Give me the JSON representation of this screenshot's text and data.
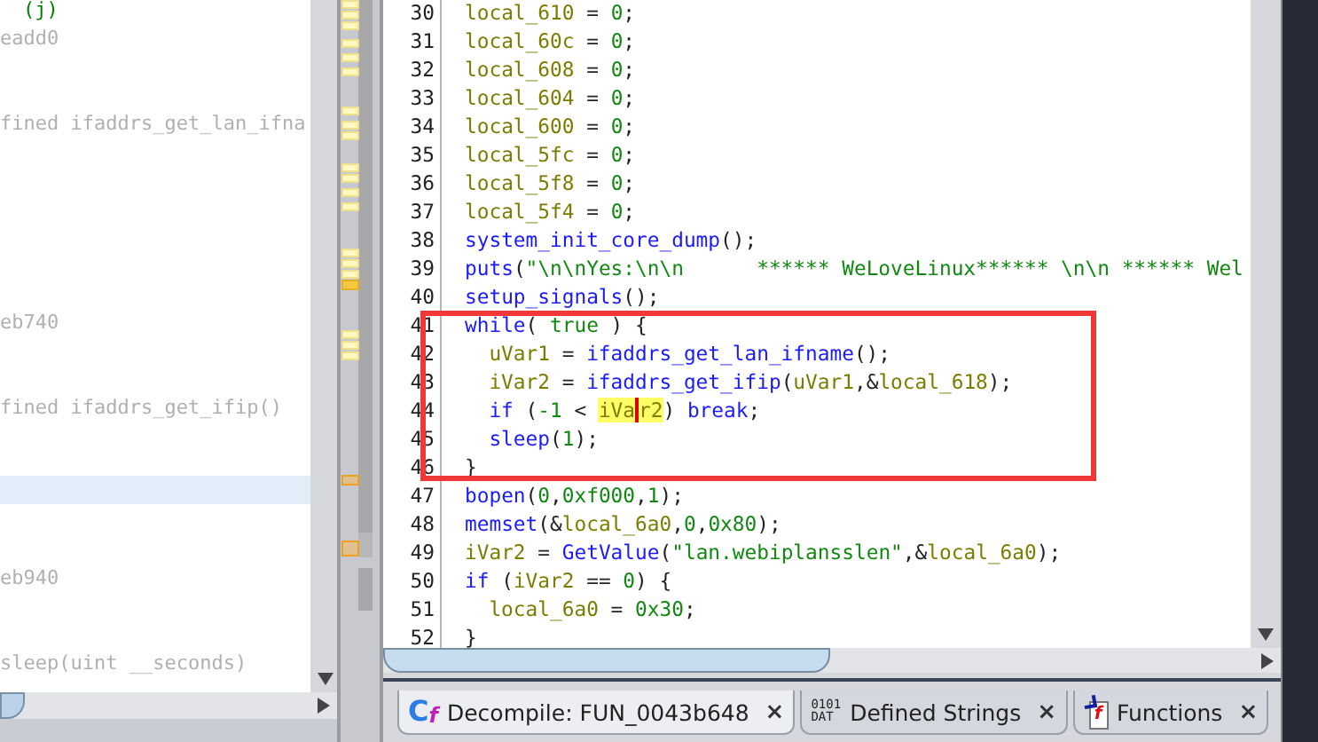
{
  "listing": {
    "lines": [
      {
        "text": "(j)",
        "kind": "code",
        "selected": false
      },
      {
        "text": "eadd0",
        "kind": "addr",
        "selected": false
      },
      {
        "selected": false
      },
      {
        "selected": false
      },
      {
        "text": "fined ifaddrs_get_lan_ifna",
        "kind": "addr",
        "selected": false
      },
      {
        "selected": false
      },
      {
        "selected": false
      },
      {
        "selected": false
      },
      {
        "selected": false
      },
      {
        "selected": false
      },
      {
        "selected": false
      },
      {
        "text": "eb740",
        "kind": "addr",
        "selected": false
      },
      {
        "selected": false
      },
      {
        "selected": false
      },
      {
        "text": "fined ifaddrs_get_ifip()",
        "kind": "addr",
        "selected": false
      },
      {
        "selected": false
      },
      {
        "selected": false
      },
      {
        "selected": true
      },
      {
        "selected": false
      },
      {
        "selected": false
      },
      {
        "text": "eb940",
        "kind": "addr",
        "selected": false
      },
      {
        "selected": false
      },
      {
        "selected": false
      },
      {
        "text": "sleep(uint __seconds)",
        "kind": "addr",
        "selected": false
      }
    ]
  },
  "decompiler": {
    "lines": [
      {
        "number": "30",
        "boxed": false,
        "tokens": [
          {
            "kind": "var",
            "t": "local_610"
          },
          {
            "kind": "p",
            "t": " = "
          },
          {
            "kind": "num",
            "t": "0"
          },
          {
            "kind": "p",
            "t": ";"
          }
        ]
      },
      {
        "number": "31",
        "boxed": false,
        "tokens": [
          {
            "kind": "var",
            "t": "local_60c"
          },
          {
            "kind": "p",
            "t": " = "
          },
          {
            "kind": "num",
            "t": "0"
          },
          {
            "kind": "p",
            "t": ";"
          }
        ]
      },
      {
        "number": "32",
        "boxed": false,
        "tokens": [
          {
            "kind": "var",
            "t": "local_608"
          },
          {
            "kind": "p",
            "t": " = "
          },
          {
            "kind": "num",
            "t": "0"
          },
          {
            "kind": "p",
            "t": ";"
          }
        ]
      },
      {
        "number": "33",
        "boxed": false,
        "tokens": [
          {
            "kind": "var",
            "t": "local_604"
          },
          {
            "kind": "p",
            "t": " = "
          },
          {
            "kind": "num",
            "t": "0"
          },
          {
            "kind": "p",
            "t": ";"
          }
        ]
      },
      {
        "number": "34",
        "boxed": false,
        "tokens": [
          {
            "kind": "var",
            "t": "local_600"
          },
          {
            "kind": "p",
            "t": " = "
          },
          {
            "kind": "num",
            "t": "0"
          },
          {
            "kind": "p",
            "t": ";"
          }
        ]
      },
      {
        "number": "35",
        "boxed": false,
        "tokens": [
          {
            "kind": "var",
            "t": "local_5fc"
          },
          {
            "kind": "p",
            "t": " = "
          },
          {
            "kind": "num",
            "t": "0"
          },
          {
            "kind": "p",
            "t": ";"
          }
        ]
      },
      {
        "number": "36",
        "boxed": false,
        "tokens": [
          {
            "kind": "var",
            "t": "local_5f8"
          },
          {
            "kind": "p",
            "t": " = "
          },
          {
            "kind": "num",
            "t": "0"
          },
          {
            "kind": "p",
            "t": ";"
          }
        ]
      },
      {
        "number": "37",
        "boxed": false,
        "tokens": [
          {
            "kind": "var",
            "t": "local_5f4"
          },
          {
            "kind": "p",
            "t": " = "
          },
          {
            "kind": "num",
            "t": "0"
          },
          {
            "kind": "p",
            "t": ";"
          }
        ]
      },
      {
        "number": "38",
        "boxed": false,
        "tokens": [
          {
            "kind": "fn",
            "t": "system_init_core_dump"
          },
          {
            "kind": "p",
            "t": "();"
          }
        ]
      },
      {
        "number": "39",
        "boxed": false,
        "tokens": [
          {
            "kind": "fn",
            "t": "puts"
          },
          {
            "kind": "p",
            "t": "("
          },
          {
            "kind": "str",
            "t": "\"\\n\\nYes:\\n\\n      ****** WeLoveLinux****** \\n\\n ****** Wel"
          }
        ]
      },
      {
        "number": "40",
        "boxed": false,
        "tokens": [
          {
            "kind": "fn",
            "t": "setup_signals"
          },
          {
            "kind": "p",
            "t": "();"
          }
        ]
      },
      {
        "number": "41",
        "boxed": true,
        "tokens": [
          {
            "kind": "fn",
            "t": "while"
          },
          {
            "kind": "p",
            "t": "( "
          },
          {
            "kind": "num",
            "t": "true"
          },
          {
            "kind": "p",
            "t": " ) {"
          }
        ],
        "children": [
          {
            "number": "42",
            "boxed": true,
            "tokens": [
              {
                "kind": "var",
                "t": "uVar1"
              },
              {
                "kind": "p",
                "t": " = "
              },
              {
                "kind": "fn",
                "t": "ifaddrs_get_lan_ifname"
              },
              {
                "kind": "p",
                "t": "();"
              }
            ]
          },
          {
            "number": "43",
            "boxed": true,
            "tokens": [
              {
                "kind": "var",
                "t": "iVar2"
              },
              {
                "kind": "p",
                "t": " = "
              },
              {
                "kind": "fn",
                "t": "ifaddrs_get_ifip"
              },
              {
                "kind": "p",
                "t": "("
              },
              {
                "kind": "var",
                "t": "uVar1"
              },
              {
                "kind": "p",
                "t": ",&"
              },
              {
                "kind": "var",
                "t": "local_618"
              },
              {
                "kind": "p",
                "t": ");"
              }
            ]
          },
          {
            "number": "44",
            "boxed": true,
            "tokens": [
              {
                "kind": "fn",
                "t": "if"
              },
              {
                "kind": "p",
                "t": " ("
              },
              {
                "kind": "num",
                "t": "-1"
              },
              {
                "kind": "p",
                "t": " < "
              },
              {
                "kind": "var-hl",
                "t": "iVa"
              },
              {
                "kind": "cursor"
              },
              {
                "kind": "var-hl",
                "t": "r2"
              },
              {
                "kind": "p",
                "t": ") "
              },
              {
                "kind": "fn",
                "t": "break"
              },
              {
                "kind": "p",
                "t": ";"
              }
            ]
          },
          {
            "number": "45",
            "boxed": true,
            "tokens": [
              {
                "kind": "fn",
                "t": "sleep"
              },
              {
                "kind": "p",
                "t": "("
              },
              {
                "kind": "num",
                "t": "1"
              },
              {
                "kind": "p",
                "t": ");"
              }
            ]
          }
        ]
      },
      {
        "number": "46",
        "boxed": true,
        "tokens": [
          {
            "kind": "p",
            "t": "}"
          }
        ]
      },
      {
        "number": "47",
        "boxed": false,
        "tokens": [
          {
            "kind": "fn",
            "t": "bopen"
          },
          {
            "kind": "p",
            "t": "("
          },
          {
            "kind": "num",
            "t": "0"
          },
          {
            "kind": "p",
            "t": ","
          },
          {
            "kind": "num",
            "t": "0xf000"
          },
          {
            "kind": "p",
            "t": ","
          },
          {
            "kind": "num",
            "t": "1"
          },
          {
            "kind": "p",
            "t": ");"
          }
        ]
      },
      {
        "number": "48",
        "boxed": false,
        "tokens": [
          {
            "kind": "fn",
            "t": "memset"
          },
          {
            "kind": "p",
            "t": "(&"
          },
          {
            "kind": "var",
            "t": "local_6a0"
          },
          {
            "kind": "p",
            "t": ","
          },
          {
            "kind": "num",
            "t": "0"
          },
          {
            "kind": "p",
            "t": ","
          },
          {
            "kind": "num",
            "t": "0x80"
          },
          {
            "kind": "p",
            "t": ");"
          }
        ]
      },
      {
        "number": "49",
        "boxed": false,
        "tokens": [
          {
            "kind": "var",
            "t": "iVar2"
          },
          {
            "kind": "p",
            "t": " = "
          },
          {
            "kind": "fn",
            "t": "GetValue"
          },
          {
            "kind": "p",
            "t": "("
          },
          {
            "kind": "str",
            "t": "\"lan.webiplansslen\""
          },
          {
            "kind": "p",
            "t": ",&"
          },
          {
            "kind": "var",
            "t": "local_6a0"
          },
          {
            "kind": "p",
            "t": ");"
          }
        ]
      },
      {
        "number": "50",
        "boxed": false,
        "tokens": [
          {
            "kind": "fn",
            "t": "if"
          },
          {
            "kind": "p",
            "t": " ("
          },
          {
            "kind": "var",
            "t": "iVar2"
          },
          {
            "kind": "p",
            "t": " == "
          },
          {
            "kind": "num",
            "t": "0"
          },
          {
            "kind": "p",
            "t": ") {"
          }
        ],
        "children": [
          {
            "number": "51",
            "boxed": false,
            "tokens": [
              {
                "kind": "var",
                "t": "local_6a0"
              },
              {
                "kind": "p",
                "t": " = "
              },
              {
                "kind": "num",
                "t": "0x30"
              },
              {
                "kind": "p",
                "t": ";"
              }
            ]
          }
        ]
      },
      {
        "number": "52",
        "boxed": false,
        "tokens": [
          {
            "kind": "p",
            "t": "}"
          }
        ]
      }
    ]
  },
  "tabs": [
    {
      "label": "Decompile: FUN_0043b648",
      "kind": "decompile",
      "icon_text": [
        "C",
        "f"
      ],
      "close": "×",
      "selected": true
    },
    {
      "label": "Defined Strings",
      "kind": "data",
      "icon_text": [
        "0101",
        "DAT"
      ],
      "close": "×",
      "selected": false
    },
    {
      "label": "Functions",
      "kind": "function",
      "icon_text": [
        "f"
      ],
      "close": "×",
      "selected": false
    }
  ]
}
